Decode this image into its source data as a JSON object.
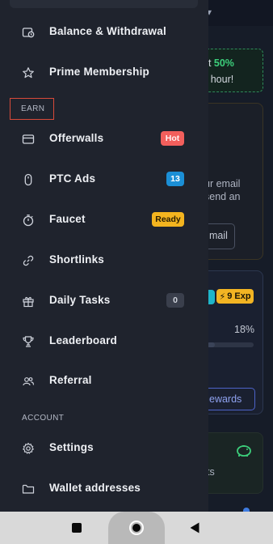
{
  "background": {
    "promo": {
      "line1_prefix": "et ",
      "line1_highlight": "50%",
      "line2": "y hour!"
    },
    "email_card": {
      "line1": "ur email",
      "line2": "send an"
    },
    "email_button": "mail",
    "level": {
      "exp_badge": "9 Exp",
      "progress_text": "18%",
      "progress_value": 0.18
    },
    "rewards_button": "ewards",
    "piggy_card_text": "ts"
  },
  "drawer": {
    "top_items": [
      {
        "label": "Balance & Withdrawal",
        "icon": "wallet-clock-icon"
      },
      {
        "label": "Prime Membership",
        "icon": "star-icon"
      }
    ],
    "earn_section": {
      "title": "EARN",
      "items": [
        {
          "label": "Offerwalls",
          "icon": "card-icon",
          "badge": "Hot"
        },
        {
          "label": "PTC Ads",
          "icon": "mouse-icon",
          "badge": "13"
        },
        {
          "label": "Faucet",
          "icon": "timer-icon",
          "badge": "Ready"
        },
        {
          "label": "Shortlinks",
          "icon": "link-icon"
        },
        {
          "label": "Daily Tasks",
          "icon": "gift-icon",
          "badge": "0"
        },
        {
          "label": "Leaderboard",
          "icon": "trophy-icon"
        },
        {
          "label": "Referral",
          "icon": "users-icon"
        }
      ]
    },
    "account_section": {
      "title": "ACCOUNT",
      "items": [
        {
          "label": "Settings",
          "icon": "gear-icon"
        },
        {
          "label": "Wallet addresses",
          "icon": "folder-icon"
        }
      ]
    }
  },
  "colors": {
    "drawer_bg": "#1f232d",
    "badge_hot": "#f25f5c",
    "badge_count": "#1b8fd6",
    "badge_ready": "#f3b41f",
    "badge_zero": "#3a3f4c",
    "section_highlight_border": "#d84a3a"
  },
  "system_nav": {
    "buttons": [
      "recents-square-icon",
      "home-circle-icon",
      "back-triangle-icon"
    ]
  }
}
